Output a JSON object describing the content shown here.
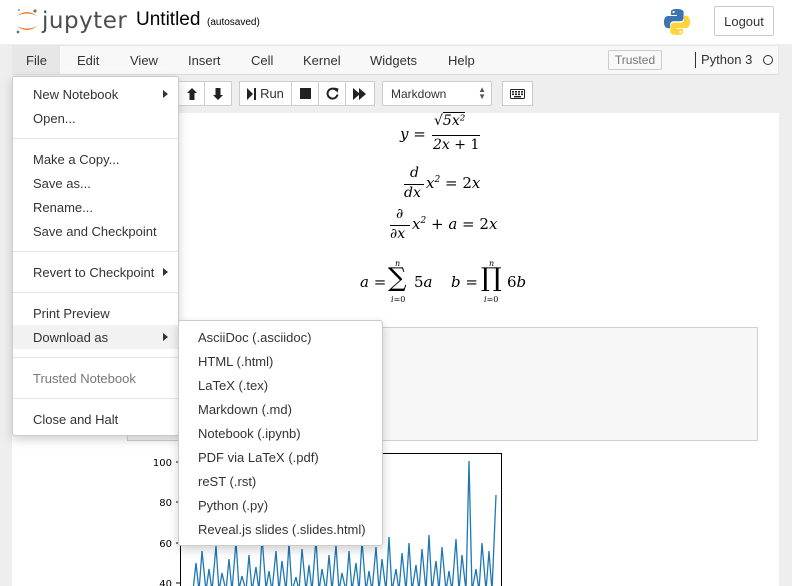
{
  "header": {
    "logo_text": "jupyter",
    "notebook_title": "Untitled",
    "autosave_status": "(autosaved)",
    "logout_label": "Logout"
  },
  "menubar": {
    "items": [
      "File",
      "Edit",
      "View",
      "Insert",
      "Cell",
      "Kernel",
      "Widgets",
      "Help"
    ],
    "active": "File",
    "trusted_label": "Trusted",
    "kernel_name": "Python 3"
  },
  "toolbar": {
    "run_label": "Run",
    "cell_type": "Markdown"
  },
  "file_menu": {
    "items": [
      {
        "label": "New Notebook",
        "submenu": true
      },
      {
        "label": "Open..."
      },
      {
        "label": "Make a Copy..."
      },
      {
        "label": "Save as..."
      },
      {
        "label": "Rename..."
      },
      {
        "label": "Save and Checkpoint"
      },
      {
        "label": "Revert to Checkpoint",
        "submenu": true
      },
      {
        "label": "Print Preview"
      },
      {
        "label": "Download as",
        "submenu": true,
        "highlighted": true
      },
      {
        "label": "Trusted Notebook",
        "disabled": true
      },
      {
        "label": "Close and Halt"
      }
    ]
  },
  "download_menu": {
    "items": [
      "AsciiDoc (.asciidoc)",
      "HTML (.html)",
      "LaTeX (.tex)",
      "Markdown (.md)",
      "Notebook (.ipynb)",
      "PDF via LaTeX (.pdf)",
      "reST (.rst)",
      "Python (.py)",
      "Reveal.js slides (.slides.html)"
    ]
  },
  "notebook": {
    "equations": [
      "y = √(5x²) / (2x + 1)",
      "d/dx x² = 2x",
      "∂/∂x x² + a = 2x",
      "a = Σ_{i=0}^{n} 5a    b = Π_{i=0}^{n} 6b"
    ],
    "plot": {
      "y_ticks": [
        "100",
        "80",
        "60",
        "40"
      ]
    }
  },
  "colors": {
    "jupyter_orange": "#f37726",
    "plot_line": "#1f77b4",
    "menu_highlight": "#f2f2f2"
  }
}
